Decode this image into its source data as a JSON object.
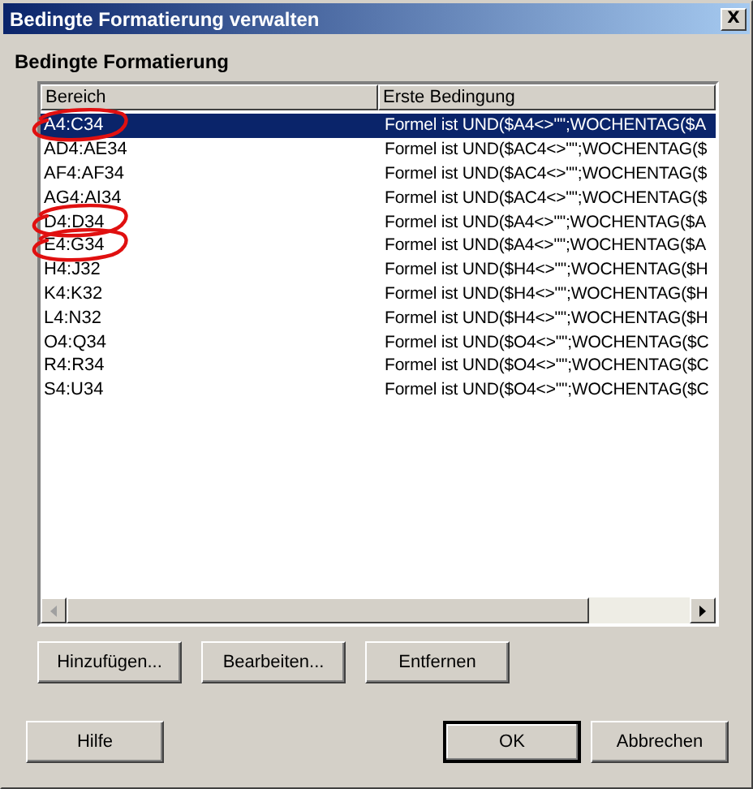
{
  "window": {
    "title": "Bedingte Formatierung verwalten",
    "close": "X"
  },
  "group": {
    "label": "Bedingte Formatierung"
  },
  "table": {
    "columns": [
      "Bereich",
      "Erste Bedingung"
    ],
    "rows": [
      {
        "range": "A4:C34",
        "condition": "Formel ist UND($A4<>\"\";WOCHENTAG($A",
        "selected": true,
        "circled": true
      },
      {
        "range": "AD4:AE34",
        "condition": "Formel ist UND($AC4<>\"\";WOCHENTAG($",
        "selected": false,
        "circled": false
      },
      {
        "range": "AF4:AF34",
        "condition": "Formel ist UND($AC4<>\"\";WOCHENTAG($",
        "selected": false,
        "circled": false
      },
      {
        "range": "AG4:AI34",
        "condition": "Formel ist UND($AC4<>\"\";WOCHENTAG($",
        "selected": false,
        "circled": false
      },
      {
        "range": "D4:D34",
        "condition": "Formel ist UND($A4<>\"\";WOCHENTAG($A",
        "selected": false,
        "circled": true
      },
      {
        "range": "E4:G34",
        "condition": "Formel ist UND($A4<>\"\";WOCHENTAG($A",
        "selected": false,
        "circled": true
      },
      {
        "range": "H4:J32",
        "condition": "Formel ist UND($H4<>\"\";WOCHENTAG($H",
        "selected": false,
        "circled": false
      },
      {
        "range": "K4:K32",
        "condition": "Formel ist UND($H4<>\"\";WOCHENTAG($H",
        "selected": false,
        "circled": false
      },
      {
        "range": "L4:N32",
        "condition": "Formel ist UND($H4<>\"\";WOCHENTAG($H",
        "selected": false,
        "circled": false
      },
      {
        "range": "O4:Q34",
        "condition": "Formel ist UND($O4<>\"\";WOCHENTAG($C",
        "selected": false,
        "circled": false
      },
      {
        "range": "R4:R34",
        "condition": "Formel ist UND($O4<>\"\";WOCHENTAG($C",
        "selected": false,
        "circled": false
      },
      {
        "range": "S4:U34",
        "condition": "Formel ist UND($O4<>\"\";WOCHENTAG($C",
        "selected": false,
        "circled": false
      }
    ]
  },
  "actions": [
    "Hinzufügen...",
    "Bearbeiten...",
    "Entfernen"
  ],
  "footer": [
    {
      "label": "Hilfe",
      "default": false
    },
    {
      "label": "OK",
      "default": true
    },
    {
      "label": "Abbrechen",
      "default": false
    }
  ]
}
